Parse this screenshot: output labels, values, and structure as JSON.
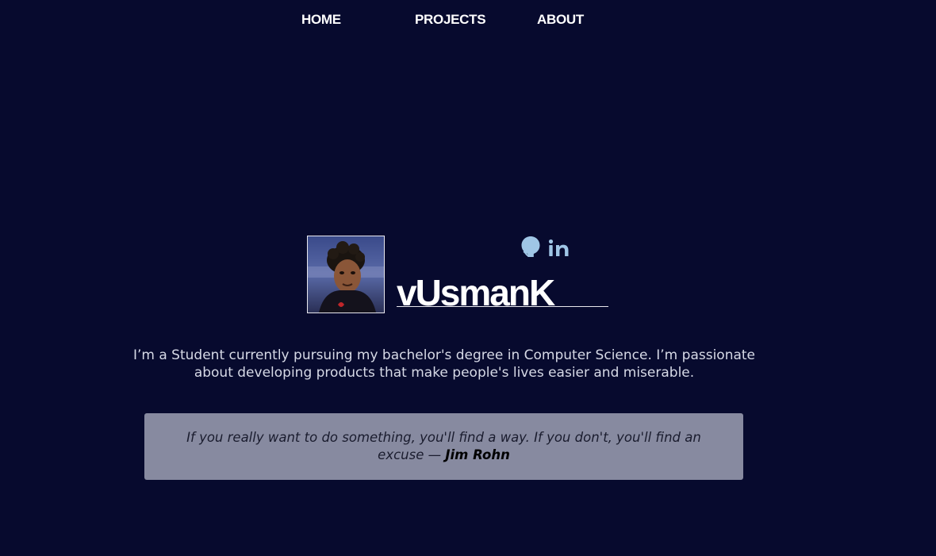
{
  "nav": {
    "home": "HOME",
    "projects": "PROJECTS",
    "about": "ABOUT"
  },
  "profile": {
    "username": "vUsmanK",
    "avatar_icon": "profile-avatar",
    "social": [
      {
        "icon": "github-icon"
      },
      {
        "icon": "linkedin-icon"
      }
    ]
  },
  "bio": "I’m a Student currently pursuing my bachelor's degree in Computer Science. I’m passionate about developing products that make people's lives easier and miserable.",
  "quote": {
    "text": "If you really want to do something, you'll find a way. If you don't, you'll find an excuse —",
    "author": "Jim Rohn"
  },
  "colors": {
    "background": "#070a2e",
    "accent_icon": "#9fc6e6",
    "quote_box": "#878aa0"
  }
}
